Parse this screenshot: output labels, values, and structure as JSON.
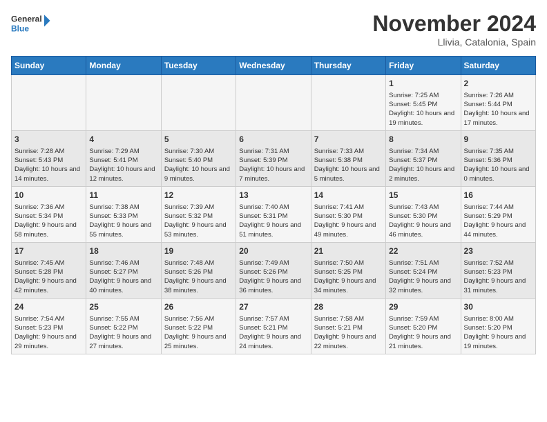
{
  "header": {
    "logo_line1": "General",
    "logo_line2": "Blue",
    "month_title": "November 2024",
    "location": "Llivia, Catalonia, Spain"
  },
  "weekdays": [
    "Sunday",
    "Monday",
    "Tuesday",
    "Wednesday",
    "Thursday",
    "Friday",
    "Saturday"
  ],
  "weeks": [
    [
      {
        "day": "",
        "info": ""
      },
      {
        "day": "",
        "info": ""
      },
      {
        "day": "",
        "info": ""
      },
      {
        "day": "",
        "info": ""
      },
      {
        "day": "",
        "info": ""
      },
      {
        "day": "1",
        "info": "Sunrise: 7:25 AM\nSunset: 5:45 PM\nDaylight: 10 hours and 19 minutes."
      },
      {
        "day": "2",
        "info": "Sunrise: 7:26 AM\nSunset: 5:44 PM\nDaylight: 10 hours and 17 minutes."
      }
    ],
    [
      {
        "day": "3",
        "info": "Sunrise: 7:28 AM\nSunset: 5:43 PM\nDaylight: 10 hours and 14 minutes."
      },
      {
        "day": "4",
        "info": "Sunrise: 7:29 AM\nSunset: 5:41 PM\nDaylight: 10 hours and 12 minutes."
      },
      {
        "day": "5",
        "info": "Sunrise: 7:30 AM\nSunset: 5:40 PM\nDaylight: 10 hours and 9 minutes."
      },
      {
        "day": "6",
        "info": "Sunrise: 7:31 AM\nSunset: 5:39 PM\nDaylight: 10 hours and 7 minutes."
      },
      {
        "day": "7",
        "info": "Sunrise: 7:33 AM\nSunset: 5:38 PM\nDaylight: 10 hours and 5 minutes."
      },
      {
        "day": "8",
        "info": "Sunrise: 7:34 AM\nSunset: 5:37 PM\nDaylight: 10 hours and 2 minutes."
      },
      {
        "day": "9",
        "info": "Sunrise: 7:35 AM\nSunset: 5:36 PM\nDaylight: 10 hours and 0 minutes."
      }
    ],
    [
      {
        "day": "10",
        "info": "Sunrise: 7:36 AM\nSunset: 5:34 PM\nDaylight: 9 hours and 58 minutes."
      },
      {
        "day": "11",
        "info": "Sunrise: 7:38 AM\nSunset: 5:33 PM\nDaylight: 9 hours and 55 minutes."
      },
      {
        "day": "12",
        "info": "Sunrise: 7:39 AM\nSunset: 5:32 PM\nDaylight: 9 hours and 53 minutes."
      },
      {
        "day": "13",
        "info": "Sunrise: 7:40 AM\nSunset: 5:31 PM\nDaylight: 9 hours and 51 minutes."
      },
      {
        "day": "14",
        "info": "Sunrise: 7:41 AM\nSunset: 5:30 PM\nDaylight: 9 hours and 49 minutes."
      },
      {
        "day": "15",
        "info": "Sunrise: 7:43 AM\nSunset: 5:30 PM\nDaylight: 9 hours and 46 minutes."
      },
      {
        "day": "16",
        "info": "Sunrise: 7:44 AM\nSunset: 5:29 PM\nDaylight: 9 hours and 44 minutes."
      }
    ],
    [
      {
        "day": "17",
        "info": "Sunrise: 7:45 AM\nSunset: 5:28 PM\nDaylight: 9 hours and 42 minutes."
      },
      {
        "day": "18",
        "info": "Sunrise: 7:46 AM\nSunset: 5:27 PM\nDaylight: 9 hours and 40 minutes."
      },
      {
        "day": "19",
        "info": "Sunrise: 7:48 AM\nSunset: 5:26 PM\nDaylight: 9 hours and 38 minutes."
      },
      {
        "day": "20",
        "info": "Sunrise: 7:49 AM\nSunset: 5:26 PM\nDaylight: 9 hours and 36 minutes."
      },
      {
        "day": "21",
        "info": "Sunrise: 7:50 AM\nSunset: 5:25 PM\nDaylight: 9 hours and 34 minutes."
      },
      {
        "day": "22",
        "info": "Sunrise: 7:51 AM\nSunset: 5:24 PM\nDaylight: 9 hours and 32 minutes."
      },
      {
        "day": "23",
        "info": "Sunrise: 7:52 AM\nSunset: 5:23 PM\nDaylight: 9 hours and 31 minutes."
      }
    ],
    [
      {
        "day": "24",
        "info": "Sunrise: 7:54 AM\nSunset: 5:23 PM\nDaylight: 9 hours and 29 minutes."
      },
      {
        "day": "25",
        "info": "Sunrise: 7:55 AM\nSunset: 5:22 PM\nDaylight: 9 hours and 27 minutes."
      },
      {
        "day": "26",
        "info": "Sunrise: 7:56 AM\nSunset: 5:22 PM\nDaylight: 9 hours and 25 minutes."
      },
      {
        "day": "27",
        "info": "Sunrise: 7:57 AM\nSunset: 5:21 PM\nDaylight: 9 hours and 24 minutes."
      },
      {
        "day": "28",
        "info": "Sunrise: 7:58 AM\nSunset: 5:21 PM\nDaylight: 9 hours and 22 minutes."
      },
      {
        "day": "29",
        "info": "Sunrise: 7:59 AM\nSunset: 5:20 PM\nDaylight: 9 hours and 21 minutes."
      },
      {
        "day": "30",
        "info": "Sunrise: 8:00 AM\nSunset: 5:20 PM\nDaylight: 9 hours and 19 minutes."
      }
    ]
  ]
}
